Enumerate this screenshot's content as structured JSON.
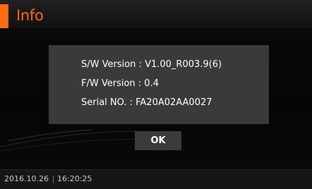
{
  "header": {
    "title": "Info"
  },
  "dialog": {
    "sw_version": "S/W Version : V1.00_R003.9(6)",
    "fw_version": "F/W Version : 0.4",
    "serial_no": "Serial NO. : FA20A02AA0027"
  },
  "ok_button": {
    "label": "OK"
  },
  "status_bar": {
    "date": "2016.10.26",
    "time": "16:20:25"
  },
  "colors": {
    "accent": "#ff6a13",
    "dialog_bg": "#3a3a3a",
    "screen_bg": "#070707"
  }
}
